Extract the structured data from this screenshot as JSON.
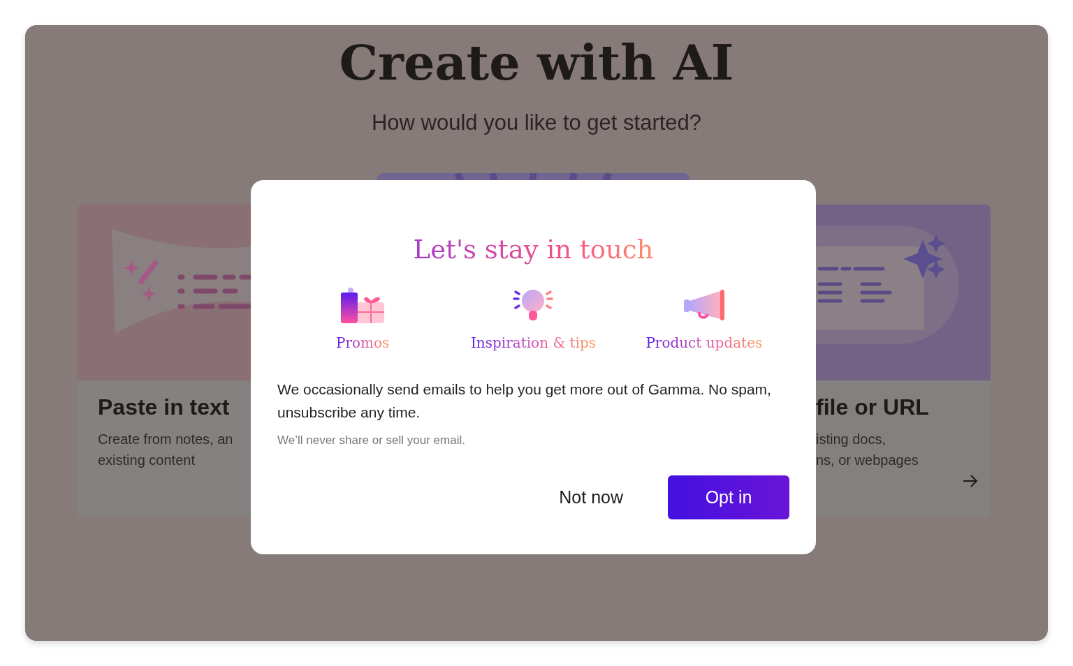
{
  "background": {
    "title": "Create with AI",
    "subtitle": "How would you like to get started?",
    "cards": [
      {
        "kind": "paste",
        "title": "Paste in text",
        "description": [
          "Create from notes, an",
          "existing content"
        ]
      },
      {
        "kind": "import",
        "title": "file or URL",
        "description": [
          "isting docs,",
          "ns, or webpages"
        ]
      }
    ]
  },
  "dialog": {
    "title": "Let's stay in touch",
    "topics": [
      {
        "kind": "gift",
        "label": "Promos"
      },
      {
        "kind": "bulb",
        "label": "Inspiration & tips"
      },
      {
        "kind": "megaphone",
        "label": "Product updates"
      }
    ],
    "message": "We occasionally send emails to help you get more out of Gamma. No spam, unsubscribe any time.",
    "note": "We’ll never share or sell your email.",
    "buttons": [
      {
        "kind": "secondary",
        "label": "Not now"
      },
      {
        "kind": "primary",
        "label": "Opt in"
      }
    ]
  }
}
